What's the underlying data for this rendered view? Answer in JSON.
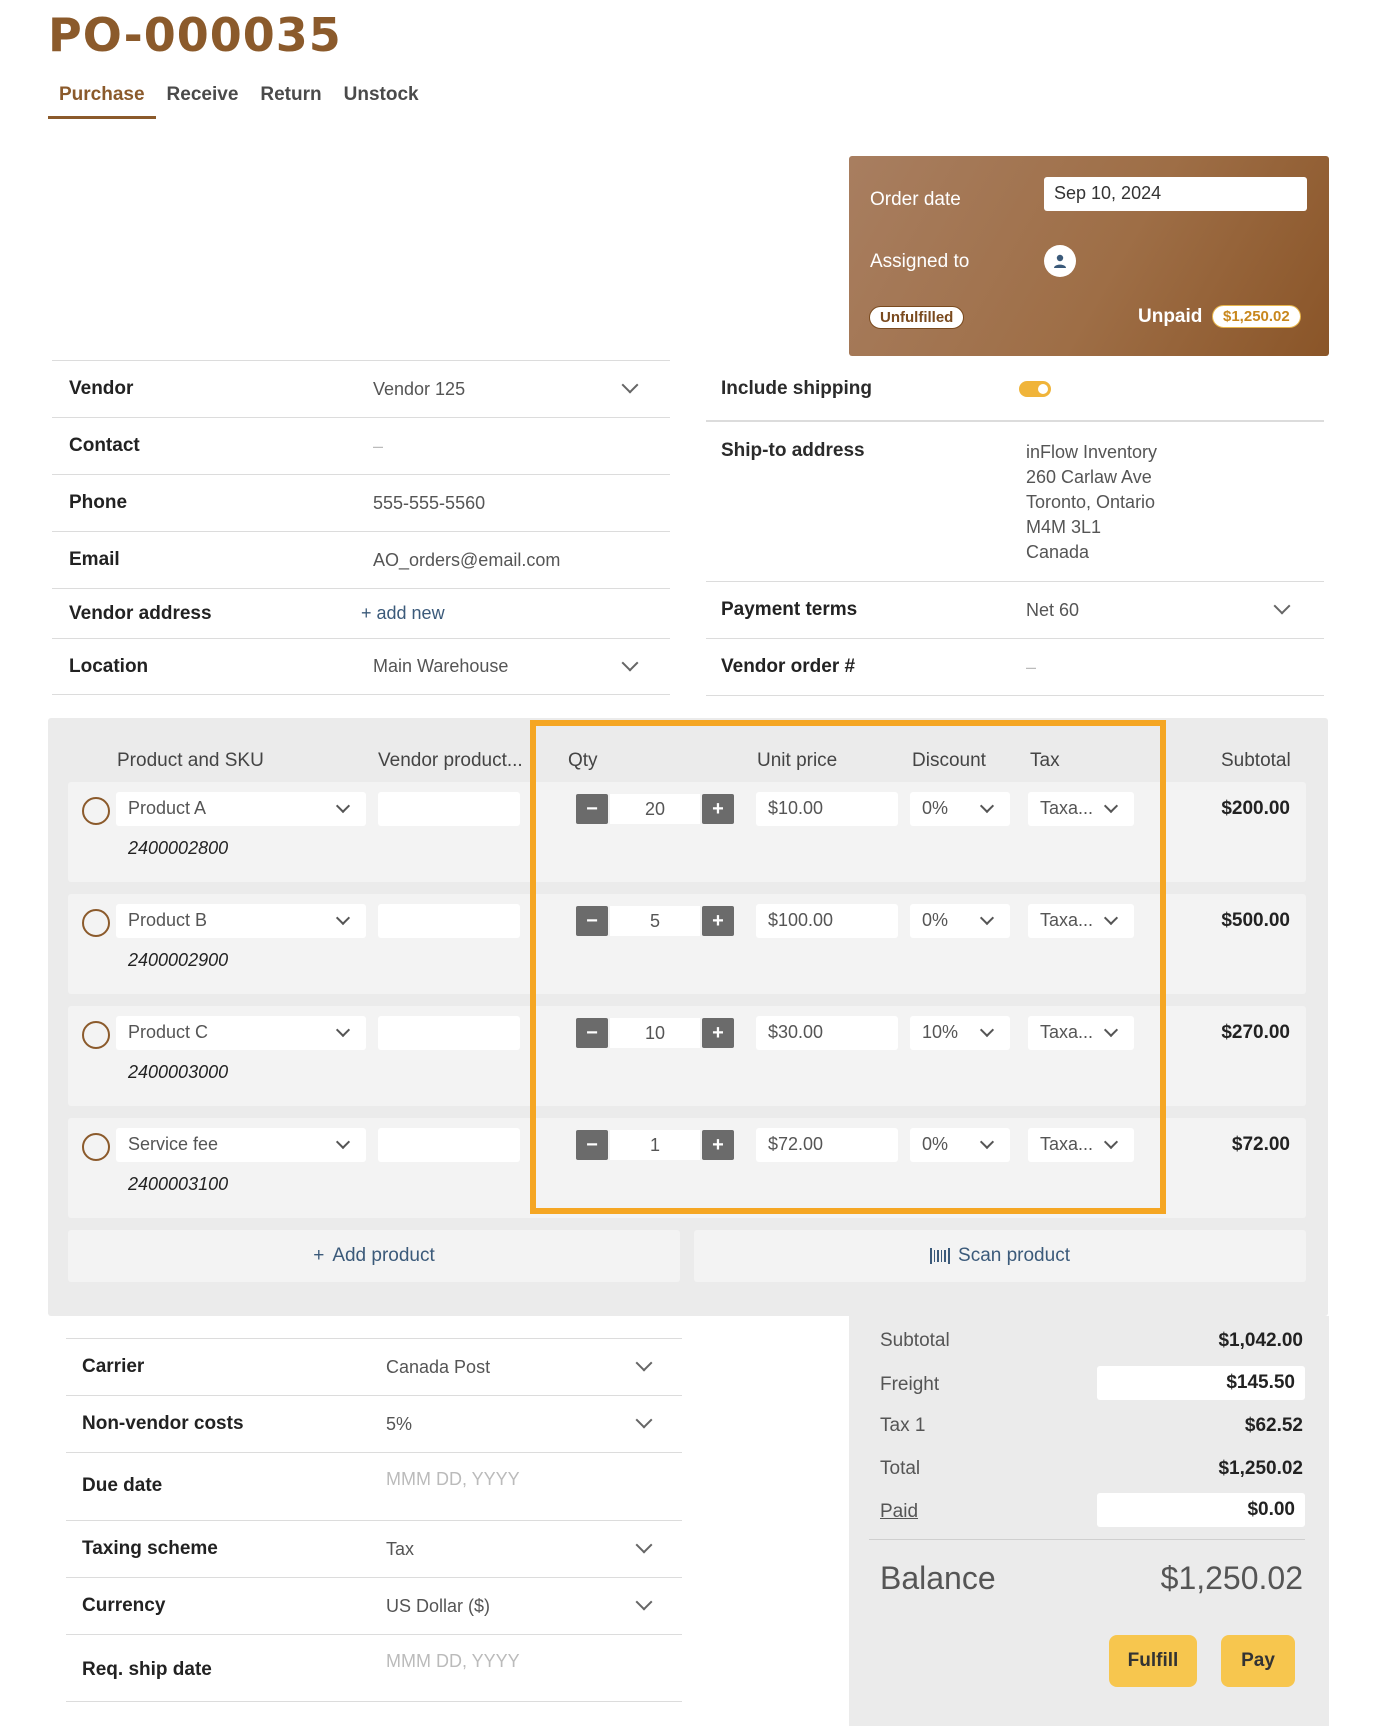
{
  "title": "PO-000035",
  "tabs": [
    {
      "label": "Purchase",
      "active": true
    },
    {
      "label": "Receive"
    },
    {
      "label": "Return"
    },
    {
      "label": "Unstock"
    }
  ],
  "order": {
    "date_label": "Order date",
    "date_value": "Sep 10, 2024",
    "assigned_label": "Assigned to",
    "status": "Unfulfilled",
    "payment_status": "Unpaid",
    "amount": "$1,250.02"
  },
  "vendor_fields": [
    {
      "label": "Vendor",
      "value": "Vendor 125",
      "dropdown": true
    },
    {
      "label": "Contact",
      "value": "–"
    },
    {
      "label": "Phone",
      "value": "555-555-5560"
    },
    {
      "label": "Email",
      "value": "AO_orders@email.com"
    },
    {
      "label": "Vendor address",
      "value": "+ add new"
    },
    {
      "label": "Location",
      "value": "Main Warehouse",
      "dropdown": true
    }
  ],
  "shipping": {
    "include_label": "Include shipping",
    "include_on": true,
    "ship_to_label": "Ship-to address",
    "address_lines": [
      "inFlow Inventory",
      "260 Carlaw Ave",
      "Toronto, Ontario",
      "M4M 3L1",
      "Canada"
    ],
    "payment_terms_label": "Payment terms",
    "payment_terms_value": "Net 60",
    "vendor_order_label": "Vendor order #",
    "vendor_order_value": "–"
  },
  "items_table": {
    "headers": {
      "product": "Product and SKU",
      "vendor_product": "Vendor product...",
      "qty": "Qty",
      "unit_price": "Unit price",
      "discount": "Discount",
      "tax": "Tax",
      "subtotal": "Subtotal"
    },
    "rows": [
      {
        "product": "Product A",
        "sku": "2400002800",
        "qty": "20",
        "unit_price": "$10.00",
        "discount": "0%",
        "tax": "Taxa...",
        "subtotal": "$200.00"
      },
      {
        "product": "Product B",
        "sku": "2400002900",
        "qty": "5",
        "unit_price": "$100.00",
        "discount": "0%",
        "tax": "Taxa...",
        "subtotal": "$500.00"
      },
      {
        "product": "Product C",
        "sku": "2400003000",
        "qty": "10",
        "unit_price": "$30.00",
        "discount": "10%",
        "tax": "Taxa...",
        "subtotal": "$270.00"
      },
      {
        "product": "Service fee",
        "sku": "2400003100",
        "qty": "1",
        "unit_price": "$72.00",
        "discount": "0%",
        "tax": "Taxa...",
        "subtotal": "$72.00"
      }
    ],
    "qty_minus": "−",
    "qty_plus": "+",
    "add_product_plus": "+",
    "add_product": "Add product",
    "scan_product": "Scan product"
  },
  "extra_fields": [
    {
      "label": "Carrier",
      "value": "Canada Post",
      "dropdown": true
    },
    {
      "label": "Non-vendor costs",
      "value": "5%",
      "dropdown": true
    },
    {
      "label": "Due date",
      "value": "MMM DD, YYYY",
      "placeholder": true
    },
    {
      "label": "Taxing scheme",
      "value": "Tax",
      "dropdown": true
    },
    {
      "label": "Currency",
      "value": "US Dollar ($)",
      "dropdown": true
    },
    {
      "label": "Req. ship date",
      "value": "MMM DD, YYYY",
      "placeholder": true
    }
  ],
  "totals": {
    "subtotal_label": "Subtotal",
    "subtotal": "$1,042.00",
    "freight_label": "Freight",
    "freight": "$145.50",
    "tax_label": "Tax 1",
    "tax": "$62.52",
    "total_label": "Total",
    "total": "$1,250.02",
    "paid_label": "Paid",
    "paid": "$0.00",
    "balance_label": "Balance",
    "balance": "$1,250.02"
  },
  "actions": {
    "fulfill": "Fulfill",
    "pay": "Pay"
  },
  "colors": {
    "brand": "#8b5a2b",
    "highlight": "#f5a623",
    "button": "#f7c64e"
  }
}
